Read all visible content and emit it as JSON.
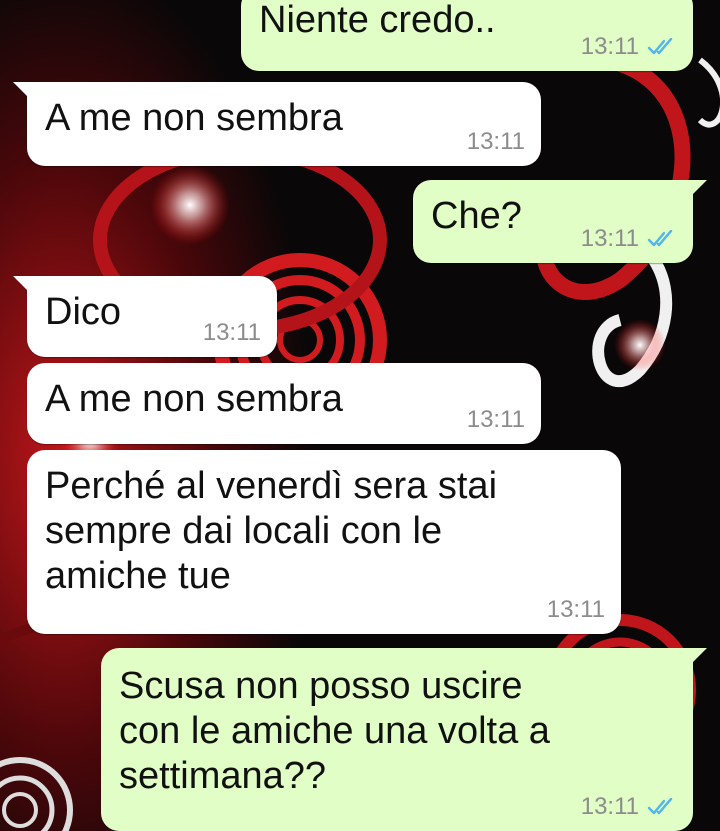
{
  "wallpaper": {
    "colors": {
      "base": "#0a0708",
      "red": "#d11b1f",
      "dark_red": "#5a0b0e",
      "white": "#f2f2f2"
    }
  },
  "messages": [
    {
      "direction": "out",
      "text": "Niente credo..",
      "time": "13:11",
      "status": "read",
      "tail": false
    },
    {
      "direction": "in",
      "text": "A me non sembra",
      "time": "13:11",
      "tail": true
    },
    {
      "direction": "out",
      "text": "Che?",
      "time": "13:11",
      "status": "read",
      "tail": true
    },
    {
      "direction": "in",
      "text": "Dico",
      "time": "13:11",
      "tail": true
    },
    {
      "direction": "in",
      "text": "A me non sembra",
      "time": "13:11",
      "tail": false
    },
    {
      "direction": "in",
      "text": "Perché al venerdì sera stai\nsempre dai locali con le\namiche tue",
      "time": "13:11",
      "tail": false
    },
    {
      "direction": "out",
      "text": "Scusa non posso uscire\ncon le amiche una volta a\nsettimana??",
      "time": "13:11",
      "status": "read",
      "tail": true
    }
  ],
  "icons": {
    "read_receipt": "double-check-icon"
  },
  "colors": {
    "incoming_bubble": "#ffffff",
    "outgoing_bubble": "#e1fec6",
    "time_text": "#8c8c8c",
    "read_tick": "#4fb6ec"
  }
}
